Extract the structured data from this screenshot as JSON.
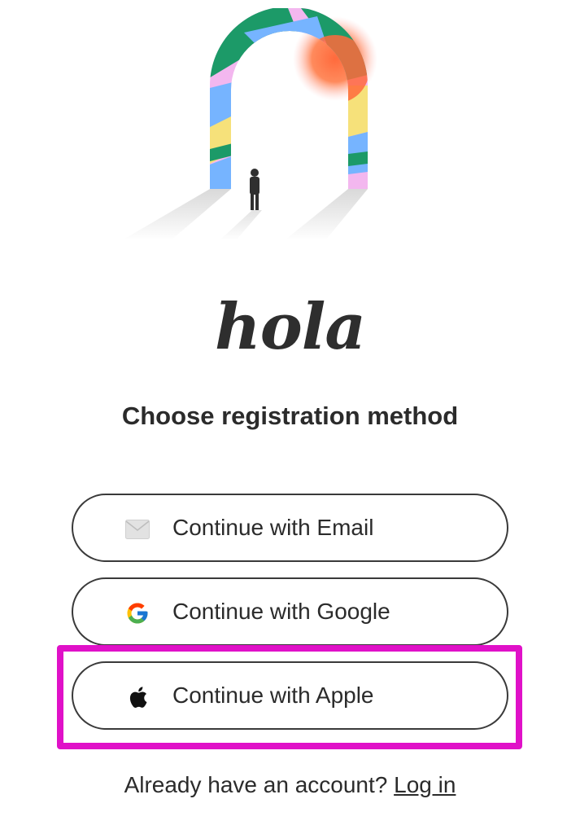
{
  "app": {
    "logo_text": "hola"
  },
  "hero": {
    "image": "arch-illustration-icon"
  },
  "main": {
    "heading": "Choose registration method",
    "buttons": [
      {
        "label": "Continue with Email",
        "icon": "envelope-icon"
      },
      {
        "label": "Continue with Google",
        "icon": "google-g-icon"
      },
      {
        "label": "Continue with Apple",
        "icon": "apple-icon"
      }
    ],
    "highlighted_button_index": 2,
    "highlight_color": "#e011c8"
  },
  "footer": {
    "prompt_text": "Already have an account?",
    "login_link": "Log in"
  }
}
